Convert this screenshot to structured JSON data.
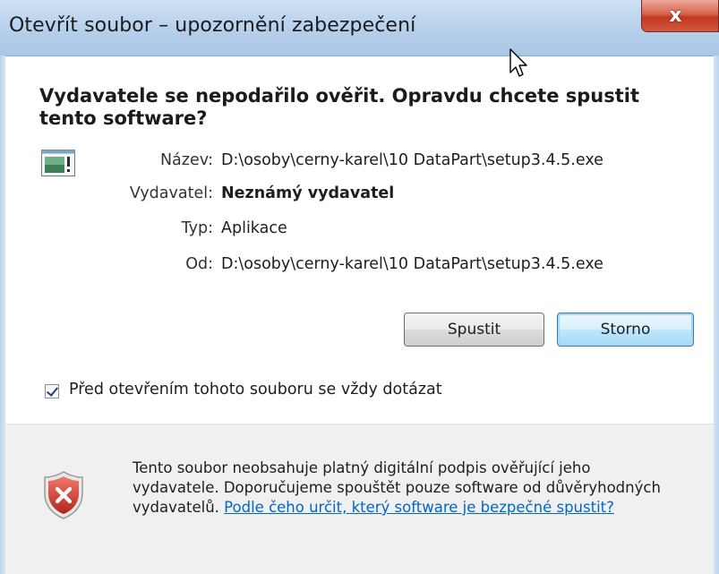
{
  "window": {
    "title": "Otevřít soubor – upozornění zabezpečení",
    "close_label": "x"
  },
  "headline": "Vydavatele se nepodařilo ověřit. Opravdu chcete spustit tento software?",
  "file_info": [
    {
      "label": "Název:",
      "value": "D:\\osoby\\cerny-karel\\10 DataPart\\setup3.4.5.exe",
      "bold": false
    },
    {
      "label": "Vydavatel:",
      "value": "Neznámý vydavatel",
      "bold": true
    },
    {
      "label": "Typ:",
      "value": "Aplikace",
      "bold": false
    },
    {
      "label": "Od:",
      "value": "D:\\osoby\\cerny-karel\\10 DataPart\\setup3.4.5.exe",
      "bold": false
    }
  ],
  "buttons": {
    "run": "Spustit",
    "cancel": "Storno"
  },
  "checkbox": {
    "label": "Před otevřením tohoto souboru se vždy dotázat",
    "checked": true
  },
  "warning": {
    "text": "Tento soubor neobsahuje platný digitální podpis ověřující jeho vydavatele. Doporučujeme spouštět pouze software od důvěryhodných vydavatelů.",
    "link": "Podle čeho určit, který software je bezpečné spustit?"
  },
  "icons": {
    "app": "application-icon",
    "warning": "shield-error-icon",
    "close": "close-icon",
    "cursor": "mouse-cursor-icon"
  }
}
